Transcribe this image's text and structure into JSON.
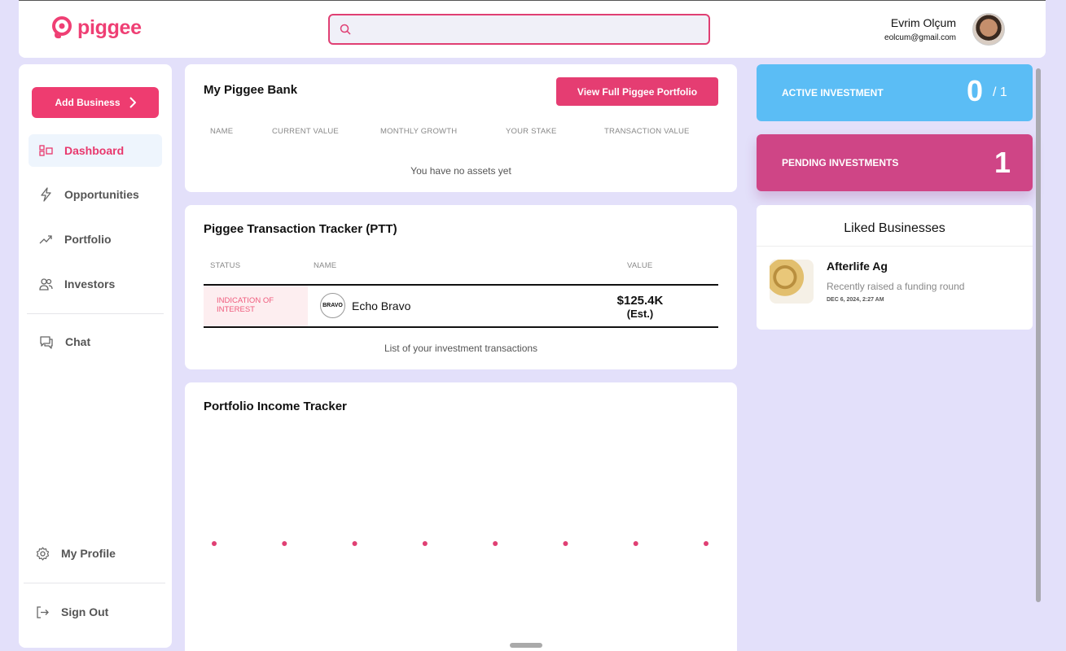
{
  "header": {
    "brand": "piggee",
    "search_placeholder": "",
    "user_name": "Evrim Olçum",
    "user_email": "eolcum@gmail.com"
  },
  "sidebar": {
    "add_button": "Add Business",
    "items": [
      {
        "label": "Dashboard",
        "icon": "dashboard-icon"
      },
      {
        "label": "Opportunities",
        "icon": "lightning-icon"
      },
      {
        "label": "Portfolio",
        "icon": "trend-up-icon"
      },
      {
        "label": "Investors",
        "icon": "users-icon"
      },
      {
        "label": "Chat",
        "icon": "chat-icon"
      }
    ],
    "profile_label": "My Profile",
    "signout_label": "Sign Out"
  },
  "bank": {
    "title": "My Piggee Bank",
    "portfolio_button": "View Full Piggee Portfolio",
    "columns": [
      "NAME",
      "CURRENT VALUE",
      "MONTHLY GROWTH",
      "YOUR STAKE",
      "TRANSACTION VALUE"
    ],
    "empty_text": "You have no assets yet"
  },
  "ptt": {
    "title": "Piggee Transaction Tracker (PTT)",
    "columns": [
      "STATUS",
      "NAME",
      "VALUE"
    ],
    "row": {
      "status": "INDICATION OF INTEREST",
      "company_logo_text": "BRAVO",
      "company": "Echo Bravo",
      "value": "$125.4K",
      "value_note": "(Est.)"
    },
    "footer": "List of your investment transactions"
  },
  "income": {
    "title": "Portfolio Income Tracker",
    "point_count": 8
  },
  "stats": {
    "active_label": "ACTIVE INVESTMENT",
    "active_value": "0",
    "active_total": "/ 1",
    "pending_label": "PENDING INVESTMENTS",
    "pending_value": "1"
  },
  "liked": {
    "title": "Liked Businesses",
    "items": [
      {
        "name": "Afterlife Ag",
        "subtitle": "Recently raised a funding round",
        "date": "DEC 6, 2024, 2:27 AM"
      }
    ]
  },
  "colors": {
    "brand_pink": "#ee3c70",
    "active_blue": "#5bbdf5",
    "pending_magenta": "#cf4586"
  }
}
